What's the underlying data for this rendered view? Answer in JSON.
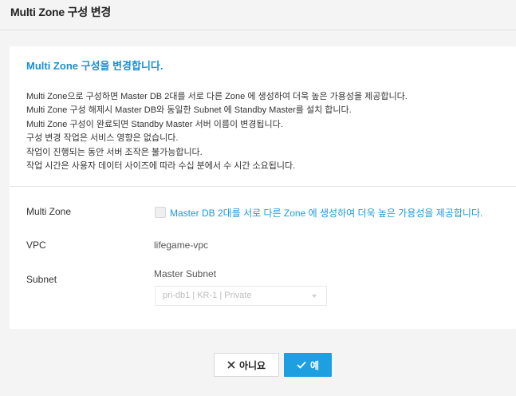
{
  "header": {
    "title": "Multi Zone 구성 변경"
  },
  "card": {
    "heading": "Multi Zone 구성을 변경합니다.",
    "description": [
      "Multi Zone으로 구성하면 Master DB 2대를 서로 다른 Zone 에 생성하여 더욱 높은 가용성을 제공합니다.",
      "Multi Zone 구성 해제시 Master DB와 동일한 Subnet 에 Standby Master를 설치 합니다.",
      "Multi Zone 구성이 완료되면 Standby Master 서버 이름이 변경됩니다.",
      "구성 변경 작업은 서비스 영향은 없습니다.",
      "작업이 진행되는 동안 서버 조작은 불가능합니다.",
      "작업 시간은 사용자 데이터 사이즈에 따라 수십 분에서 수 시간 소요됩니다."
    ]
  },
  "form": {
    "multi_zone": {
      "label": "Multi Zone",
      "checkbox_text": "Master DB 2대를 서로 다른 Zone 에 생성하여 더욱 높은 가용성을 제공합니다.",
      "checked": false
    },
    "vpc": {
      "label": "VPC",
      "value": "lifegame-vpc"
    },
    "subnet": {
      "label": "Subnet",
      "master_subnet_title": "Master Subnet",
      "selected": "pri-db1 | KR-1 | Private"
    }
  },
  "buttons": {
    "no_label": "아니요",
    "no_icon": "close-icon",
    "yes_label": "예",
    "yes_icon": "check-icon"
  },
  "colors": {
    "accent": "#1ea0e0",
    "heading": "#1b8fd1",
    "background": "#f4f4f4"
  }
}
